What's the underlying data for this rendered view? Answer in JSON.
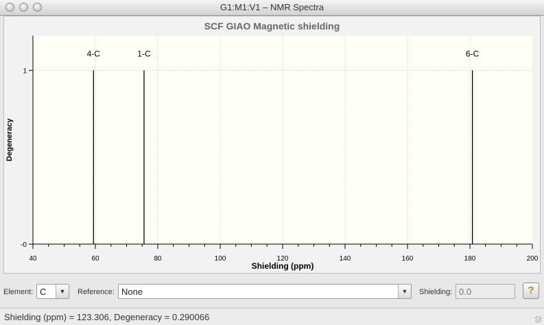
{
  "window": {
    "title": "G1:M1:V1 – NMR Spectra"
  },
  "chart_data": {
    "type": "bar",
    "title": "SCF GIAO Magnetic shielding",
    "xlabel": "Shielding (ppm)",
    "ylabel": "Degeneracy",
    "xlim": [
      40,
      200
    ],
    "ylim": [
      0,
      1.2
    ],
    "xticks": [
      40,
      60,
      80,
      100,
      120,
      140,
      160,
      180,
      200
    ],
    "yticks": [
      {
        "value": 0,
        "label": "-0"
      },
      {
        "value": 1,
        "label": "1"
      }
    ],
    "grid": true,
    "peaks": [
      {
        "label": "4-C",
        "x": 59.4,
        "y": 1
      },
      {
        "label": "1-C",
        "x": 75.6,
        "y": 1
      },
      {
        "label": "6-C",
        "x": 180.8,
        "y": 1
      }
    ],
    "colors": {
      "plot_bg": "#fffff6",
      "line": "#000000",
      "grid": "#c8c8c8"
    }
  },
  "controls": {
    "element_label": "Element:",
    "element_value": "C",
    "reference_label": "Reference:",
    "reference_value": "None",
    "shielding_label": "Shielding:",
    "shielding_value": "0.0",
    "help_icon": "question-icon"
  },
  "status": {
    "text": "Shielding (ppm) = 123.306,  Degeneracy = 0.290066"
  }
}
